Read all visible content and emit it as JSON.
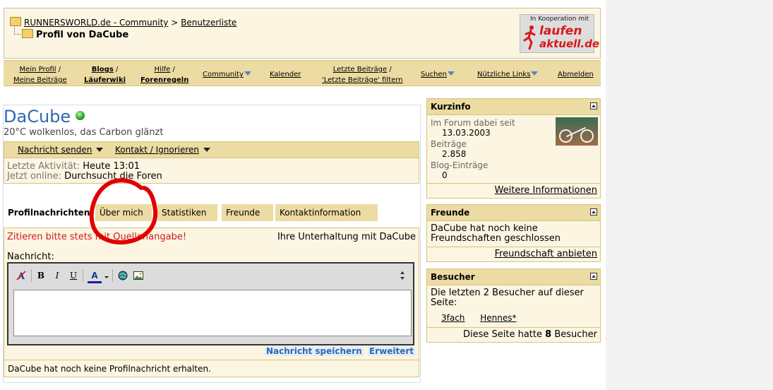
{
  "breadcrumb": {
    "site": "RUNNERSWORLD.de - Community",
    "separator": ">",
    "userlist": "Benutzerliste",
    "current": "Profil von DaCube"
  },
  "logo": {
    "coop": "In Kooperation mit",
    "line1": "laufen",
    "line2": "aktuell.de"
  },
  "nav": {
    "profile": "Mein Profil",
    "my_posts": "Meine Beiträge",
    "blogs": "Blogs",
    "laeuferwiki": "Läuferwiki",
    "help": "Hilfe",
    "forum_rules": "Forenregeln",
    "community": "Community",
    "calendar": "Kalender",
    "latest_posts": "Letzte Beiträge",
    "filter_latest": "'Letzte Beiträge' filtern",
    "search": "Suchen",
    "useful_links": "Nützliche Links",
    "logout": "Abmelden",
    "slash": "/"
  },
  "profile": {
    "username": "DaCube",
    "status": "online",
    "tagline": "20°C wolkenlos, das Carbon glänzt",
    "send_message": "Nachricht senden",
    "contact_ignore": "Kontakt / Ignorieren",
    "last_activity_label": "Letzte Aktivität:",
    "last_activity_value": "Heute 13:01",
    "online_now_label": "Jetzt online:",
    "online_now_value": "Durchsucht die Foren"
  },
  "tabs": [
    "Profilnachrichten",
    "Über mich",
    "Statistiken",
    "Freunde",
    "Kontaktinformation"
  ],
  "messages": {
    "notice": "Zitieren bitte stets mit Quellenangabe!",
    "conversation": "Ihre Unterhaltung mit DaCube",
    "label": "Nachricht:",
    "save": "Nachricht speichern",
    "advanced": "Erweitert",
    "empty": "DaCube hat noch keine Profilnachricht erhalten."
  },
  "editor_icons": [
    "remove-format-icon",
    "bold-icon",
    "italic-icon",
    "underline-icon",
    "font-color-icon",
    "link-icon",
    "image-icon",
    "resize-icon"
  ],
  "editor_labels": {
    "bold": "B",
    "italic": "I",
    "underline": "U",
    "color": "A"
  },
  "kurzinfo": {
    "title": "Kurzinfo",
    "member_since_label": "Im Forum dabei seit",
    "member_since": "13.03.2003",
    "posts_label": "Beiträge",
    "posts": "2.858",
    "blog_label": "Blog-Einträge",
    "blog": "0",
    "more": "Weitere Informationen"
  },
  "friends": {
    "title": "Freunde",
    "text": "DaCube hat noch keine Freundschaften geschlossen",
    "offer": "Freundschaft anbieten"
  },
  "visitors": {
    "title": "Besucher",
    "text": "Die letzten 2 Besucher auf dieser Seite:",
    "names": [
      "3fach",
      "Hennes*"
    ],
    "count_prefix": "Diese Seite hatte",
    "count": "8",
    "count_suffix": "Besucher"
  },
  "colors": {
    "accent_blue": "#2c6ab0",
    "nav_bg": "#ecdba2",
    "panel_bg": "#fbf5e2",
    "red": "#d21a1a",
    "annotation": "#e00000"
  }
}
